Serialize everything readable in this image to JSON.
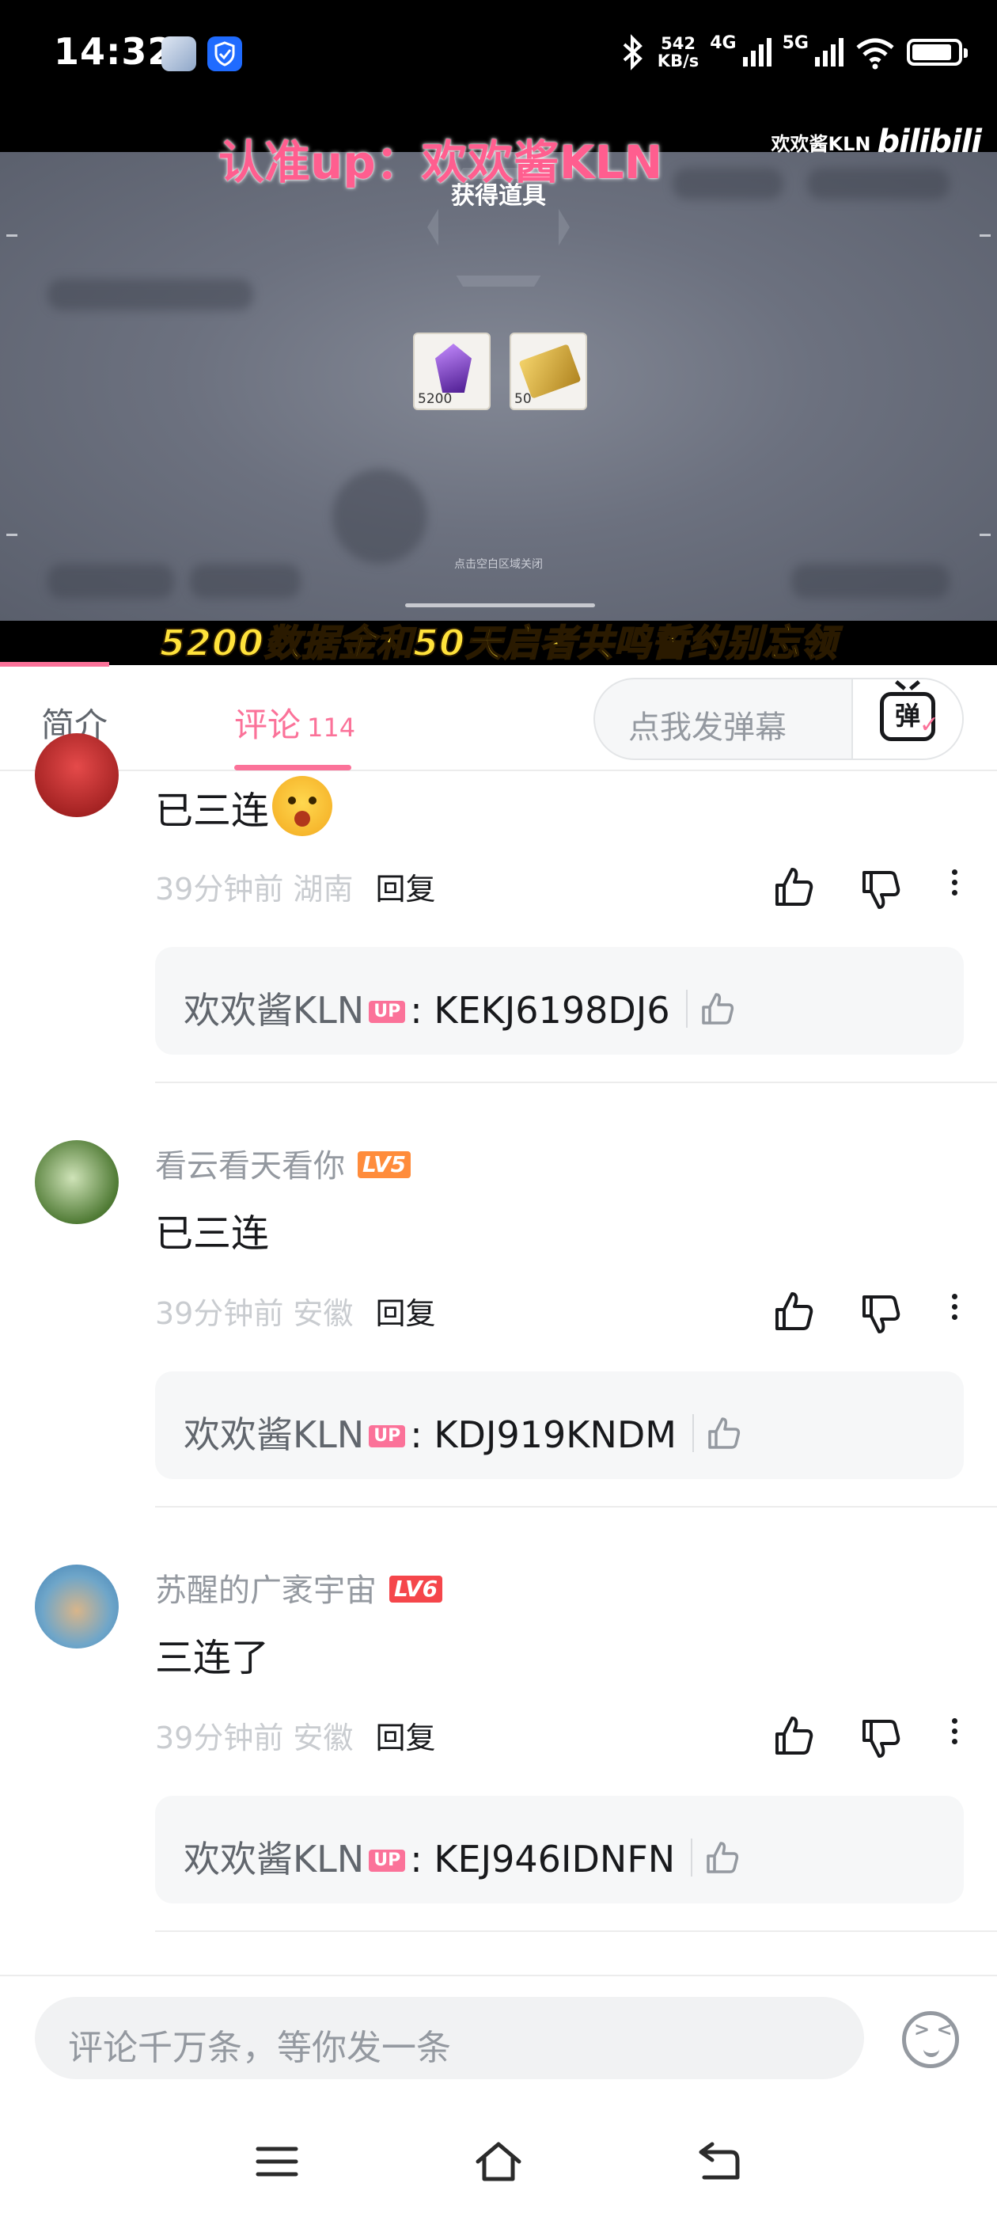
{
  "status_bar": {
    "time": "14:32",
    "speed_value": "542",
    "speed_unit": "KB/s",
    "net1": "4G",
    "net2": "5G"
  },
  "video": {
    "watermark_left": "认准up：欢欢酱KLN",
    "watermark_right_name": "欢欢酱KLN",
    "watermark_right_logo": "bilibili",
    "scene_title": "获得道具",
    "items": [
      {
        "caption": "5200",
        "icon": "purple-crystal-icon"
      },
      {
        "caption": "50",
        "icon": "gold-ticket-icon"
      }
    ],
    "hint": "点击空白区域关闭",
    "subtitle": "5200数据金和50天启者共鸣誓约别忘领"
  },
  "tabs": {
    "intro": "简介",
    "comments": "评论",
    "comments_count": "114",
    "danmaku_placeholder": "点我发弹幕",
    "danmaku_button": "弹"
  },
  "comments": [
    {
      "username": "",
      "level": "",
      "text": "已三连",
      "time_location": "39分钟前 湖南",
      "reply_label": "回复",
      "reply": {
        "author": "欢欢酱KLN",
        "tag": "UP",
        "content": ": KEKJ6198DJ6"
      }
    },
    {
      "username": "看云看天看你",
      "level": "LV5",
      "text": "已三连",
      "time_location": "39分钟前 安徽",
      "reply_label": "回复",
      "reply": {
        "author": "欢欢酱KLN",
        "tag": "UP",
        "content": ": KDJ919KNDM"
      }
    },
    {
      "username": "苏醒的广袤宇宙",
      "level": "LV6",
      "text": "三连了",
      "time_location": "39分钟前 安徽",
      "reply_label": "回复",
      "reply": {
        "author": "欢欢酱KLN",
        "tag": "UP",
        "content": ": KEJ946IDNFN"
      }
    }
  ],
  "bottom": {
    "input_placeholder": "评论千万条，等你发一条"
  },
  "colors": {
    "accent": "#fb7299",
    "lv5": "#ff8c3b",
    "lv6": "#f5464b"
  }
}
